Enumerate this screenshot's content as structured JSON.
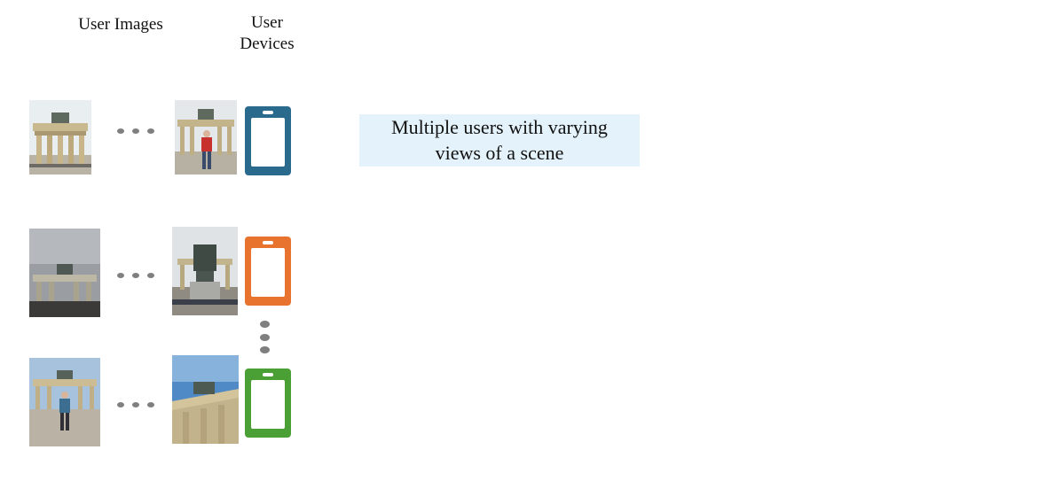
{
  "headers": {
    "user_images": "User Images",
    "user_devices_line1": "User",
    "user_devices_line2": "Devices"
  },
  "caption": {
    "line1": "Multiple users with varying",
    "line2": "views of a scene"
  },
  "devices": [
    {
      "color": "#2a6a8c"
    },
    {
      "color": "#e8732f"
    },
    {
      "color": "#4aa035"
    }
  ],
  "icons": {
    "device": "smartphone-icon",
    "horizontal_ellipsis": "ellipsis-dots",
    "vertical_ellipsis": "vertical-ellipsis-dots"
  }
}
